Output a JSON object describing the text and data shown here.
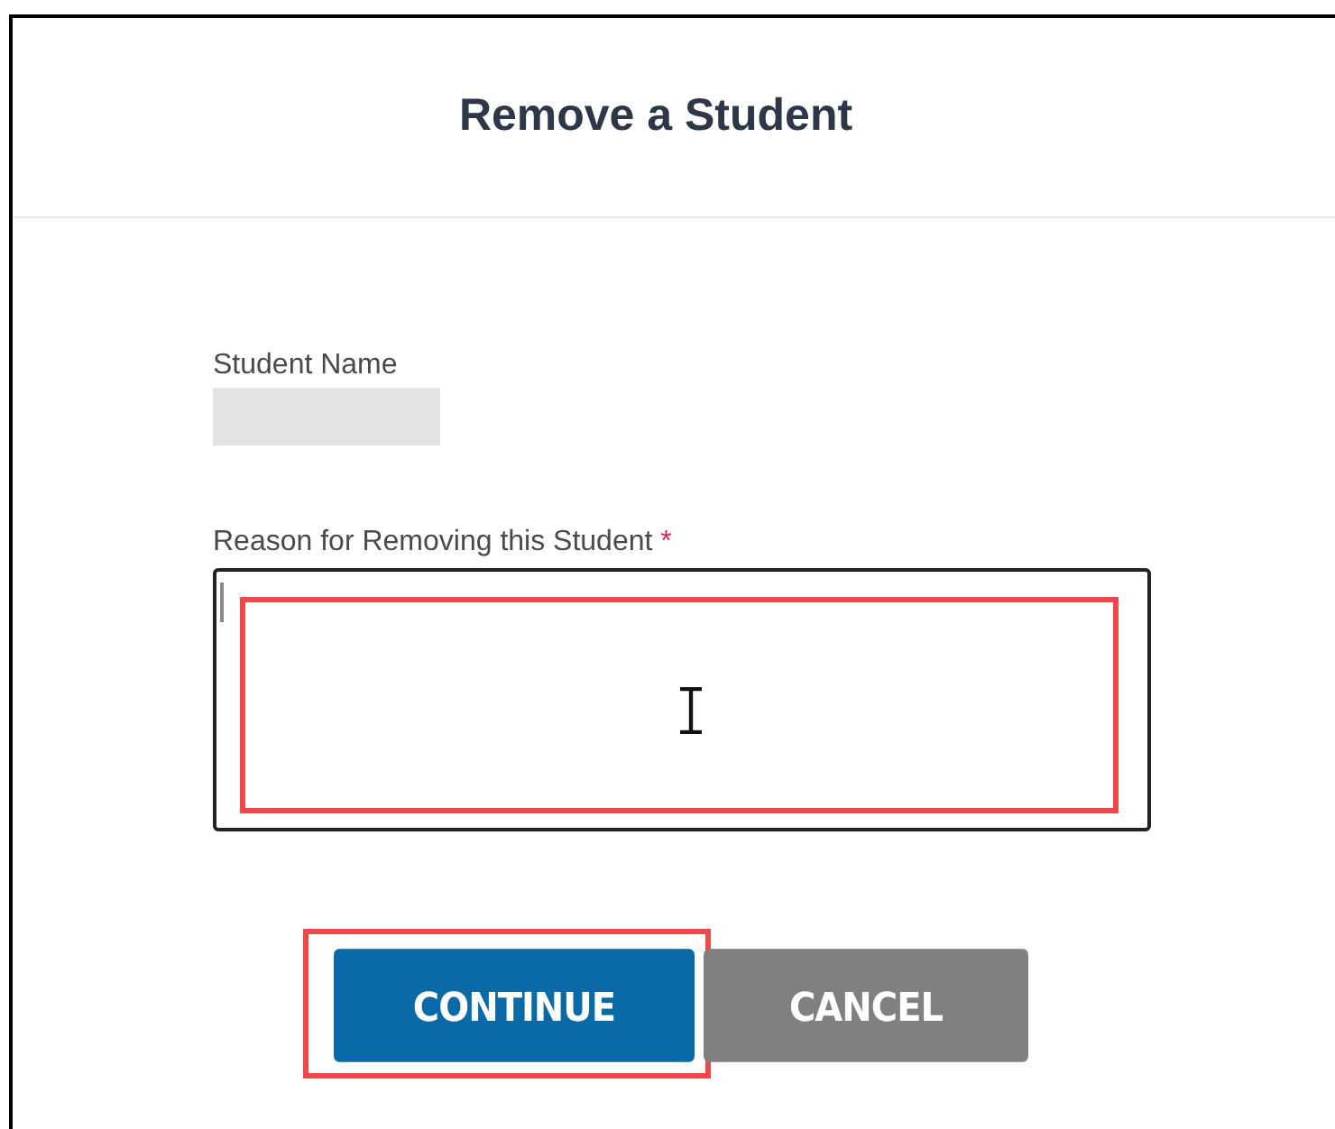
{
  "dialog": {
    "title": "Remove a Student"
  },
  "fields": [
    {
      "kind": "readonly",
      "label": "Student Name",
      "redacted": true
    },
    {
      "kind": "textarea",
      "label": "Reason for Removing this Student",
      "required": true,
      "required_mark": "*",
      "focused": true,
      "highlighted": true
    }
  ],
  "buttons": [
    {
      "label": "CONTINUE",
      "kind": "primary",
      "highlighted": true
    },
    {
      "label": "CANCEL",
      "kind": "secondary",
      "highlighted": false
    }
  ]
}
